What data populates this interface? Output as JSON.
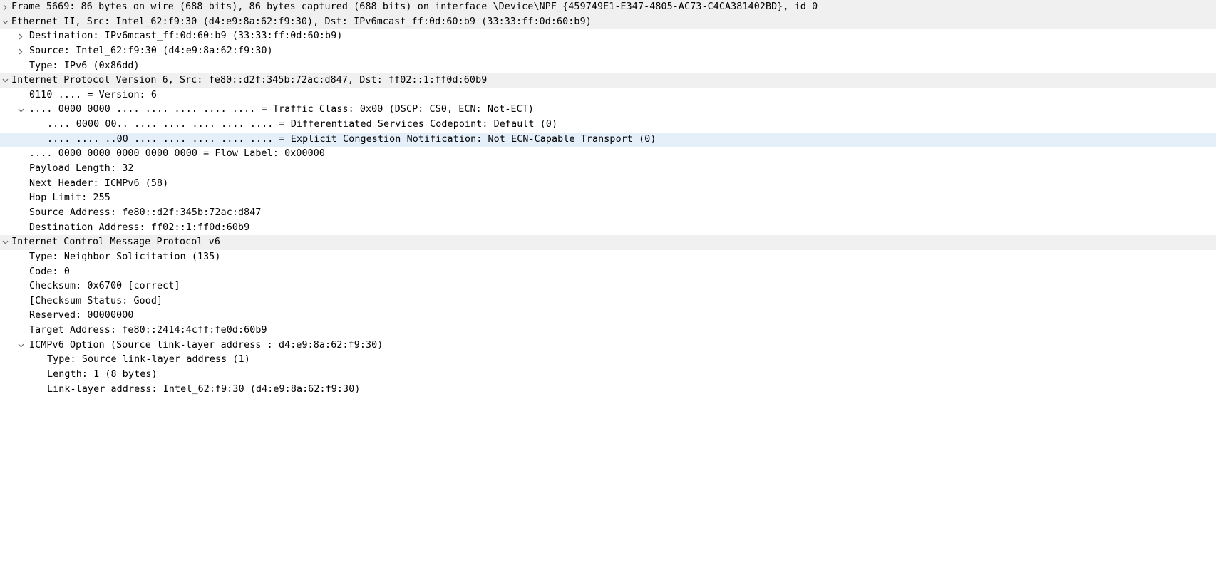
{
  "app": {
    "pane": "packet-details",
    "colors": {
      "background": "#ffffff",
      "protocol_row_background": "#f0f0f0",
      "selected_row_background": "#e4effa",
      "text": "#000000",
      "expander": "#6e6e6e"
    }
  },
  "icons": {
    "collapsed": "chevron-right-icon",
    "expanded": "chevron-down-icon"
  },
  "tree": [
    {
      "depth": 0,
      "expander": "collapsed",
      "protocol": true,
      "selected": false,
      "text": "Frame 5669: 86 bytes on wire (688 bits), 86 bytes captured (688 bits) on interface \\Device\\NPF_{459749E1-E347-4805-AC73-C4CA381402BD}, id 0"
    },
    {
      "depth": 0,
      "expander": "expanded",
      "protocol": true,
      "selected": false,
      "text": "Ethernet II, Src: Intel_62:f9:30 (d4:e9:8a:62:f9:30), Dst: IPv6mcast_ff:0d:60:b9 (33:33:ff:0d:60:b9)"
    },
    {
      "depth": 1,
      "expander": "collapsed",
      "protocol": false,
      "selected": false,
      "text": "Destination: IPv6mcast_ff:0d:60:b9 (33:33:ff:0d:60:b9)"
    },
    {
      "depth": 1,
      "expander": "collapsed",
      "protocol": false,
      "selected": false,
      "text": "Source: Intel_62:f9:30 (d4:e9:8a:62:f9:30)"
    },
    {
      "depth": 1,
      "expander": "none",
      "protocol": false,
      "selected": false,
      "text": "Type: IPv6 (0x86dd)"
    },
    {
      "depth": 0,
      "expander": "expanded",
      "protocol": true,
      "selected": false,
      "text": "Internet Protocol Version 6, Src: fe80::d2f:345b:72ac:d847, Dst: ff02::1:ff0d:60b9"
    },
    {
      "depth": 1,
      "expander": "none",
      "protocol": false,
      "selected": false,
      "text": "0110 .... = Version: 6"
    },
    {
      "depth": 1,
      "expander": "expanded",
      "protocol": false,
      "selected": false,
      "text": ".... 0000 0000 .... .... .... .... .... = Traffic Class: 0x00 (DSCP: CS0, ECN: Not-ECT)"
    },
    {
      "depth": 2,
      "expander": "none",
      "protocol": false,
      "selected": false,
      "text": ".... 0000 00.. .... .... .... .... .... = Differentiated Services Codepoint: Default (0)"
    },
    {
      "depth": 2,
      "expander": "none",
      "protocol": false,
      "selected": true,
      "text": ".... .... ..00 .... .... .... .... .... = Explicit Congestion Notification: Not ECN-Capable Transport (0)"
    },
    {
      "depth": 1,
      "expander": "none",
      "protocol": false,
      "selected": false,
      "text": ".... 0000 0000 0000 0000 0000 = Flow Label: 0x00000"
    },
    {
      "depth": 1,
      "expander": "none",
      "protocol": false,
      "selected": false,
      "text": "Payload Length: 32"
    },
    {
      "depth": 1,
      "expander": "none",
      "protocol": false,
      "selected": false,
      "text": "Next Header: ICMPv6 (58)"
    },
    {
      "depth": 1,
      "expander": "none",
      "protocol": false,
      "selected": false,
      "text": "Hop Limit: 255"
    },
    {
      "depth": 1,
      "expander": "none",
      "protocol": false,
      "selected": false,
      "text": "Source Address: fe80::d2f:345b:72ac:d847"
    },
    {
      "depth": 1,
      "expander": "none",
      "protocol": false,
      "selected": false,
      "text": "Destination Address: ff02::1:ff0d:60b9"
    },
    {
      "depth": 0,
      "expander": "expanded",
      "protocol": true,
      "selected": false,
      "text": "Internet Control Message Protocol v6"
    },
    {
      "depth": 1,
      "expander": "none",
      "protocol": false,
      "selected": false,
      "text": "Type: Neighbor Solicitation (135)"
    },
    {
      "depth": 1,
      "expander": "none",
      "protocol": false,
      "selected": false,
      "text": "Code: 0"
    },
    {
      "depth": 1,
      "expander": "none",
      "protocol": false,
      "selected": false,
      "text": "Checksum: 0x6700 [correct]"
    },
    {
      "depth": 1,
      "expander": "none",
      "protocol": false,
      "selected": false,
      "text": "[Checksum Status: Good]"
    },
    {
      "depth": 1,
      "expander": "none",
      "protocol": false,
      "selected": false,
      "text": "Reserved: 00000000"
    },
    {
      "depth": 1,
      "expander": "none",
      "protocol": false,
      "selected": false,
      "text": "Target Address: fe80::2414:4cff:fe0d:60b9"
    },
    {
      "depth": 1,
      "expander": "expanded",
      "protocol": false,
      "selected": false,
      "text": "ICMPv6 Option (Source link-layer address : d4:e9:8a:62:f9:30)"
    },
    {
      "depth": 2,
      "expander": "none",
      "protocol": false,
      "selected": false,
      "text": "Type: Source link-layer address (1)"
    },
    {
      "depth": 2,
      "expander": "none",
      "protocol": false,
      "selected": false,
      "text": "Length: 1 (8 bytes)"
    },
    {
      "depth": 2,
      "expander": "none",
      "protocol": false,
      "selected": false,
      "text": "Link-layer address: Intel_62:f9:30 (d4:e9:8a:62:f9:30)"
    }
  ]
}
